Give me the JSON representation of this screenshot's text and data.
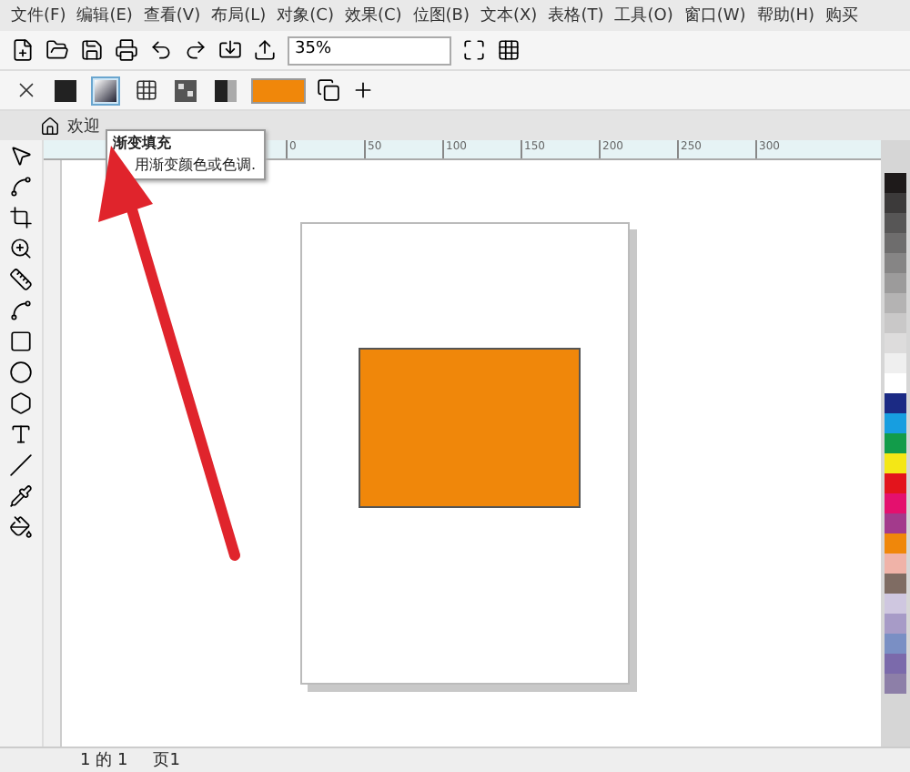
{
  "menu_bar": {
    "items": [
      "文件(F)",
      "编辑(E)",
      "查看(V)",
      "布局(L)",
      "对象(C)",
      "效果(C)",
      "位图(B)",
      "文本(X)",
      "表格(T)",
      "工具(O)",
      "窗口(W)",
      "帮助(H)",
      "购买"
    ]
  },
  "standard_toolbar": {
    "zoom": "35%"
  },
  "property_bar": {
    "fill_types": [
      {
        "kind": "none",
        "selected": false
      },
      {
        "kind": "uniform",
        "selected": false
      },
      {
        "kind": "gradient",
        "selected": true
      },
      {
        "kind": "grid",
        "selected": false
      },
      {
        "kind": "bitmap",
        "selected": false
      },
      {
        "kind": "texture",
        "selected": false
      }
    ]
  },
  "document_tabs": [
    {
      "label": "欢迎"
    }
  ],
  "tooltip": {
    "title": "渐变填充",
    "text": "用渐变颜色或色调."
  },
  "ruler": {
    "ticks": [
      "0",
      "50",
      "100",
      "150",
      "200",
      "250",
      "300"
    ]
  },
  "palette": [
    {
      "color": "#1e1a1a"
    },
    {
      "color": "#3c3a3a"
    },
    {
      "color": "#575656"
    },
    {
      "color": "#6e6d6d"
    },
    {
      "color": "#868585"
    },
    {
      "color": "#9c9b9b"
    },
    {
      "color": "#b4b3b3"
    },
    {
      "color": "#c9c8c8"
    },
    {
      "color": "#dddcdc"
    },
    {
      "color": "#efefef"
    },
    {
      "color": "#ffffff"
    },
    {
      "color": "#1b2a84"
    },
    {
      "color": "#179ee0"
    },
    {
      "color": "#129c4a"
    },
    {
      "color": "#f4e716"
    },
    {
      "color": "#e3141c"
    },
    {
      "color": "#e4106e"
    },
    {
      "color": "#a33a8c"
    },
    {
      "color": "#f0870a"
    },
    {
      "color": "#f0b3a8"
    },
    {
      "color": "#7f6c63"
    },
    {
      "color": "#cfc7e0"
    },
    {
      "color": "#a79bc7"
    },
    {
      "color": "#7a8fc4"
    },
    {
      "color": "#7b6aab"
    },
    {
      "color": "#8d7fa8"
    }
  ],
  "status_bar": {
    "page_position": "1 的 1",
    "page_tab": "页1"
  }
}
